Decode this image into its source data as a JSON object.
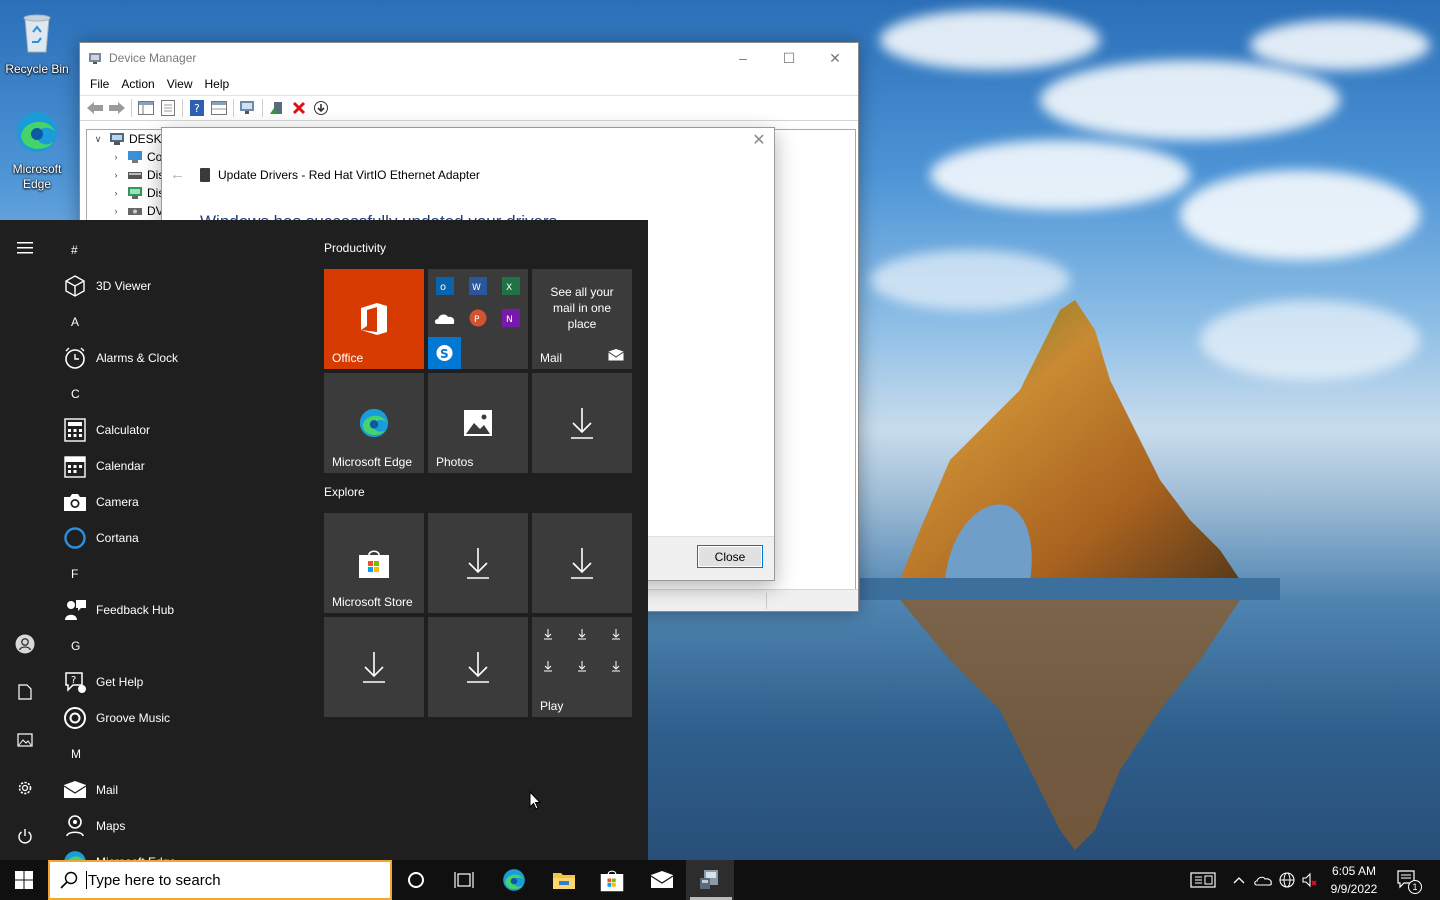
{
  "desktop": {
    "icons": [
      {
        "label": "Recycle Bin"
      },
      {
        "label": "Microsoft Edge"
      }
    ]
  },
  "device_manager": {
    "title": "Device Manager",
    "menu": [
      "File",
      "Action",
      "View",
      "Help"
    ],
    "tree": [
      {
        "label": "DESKT",
        "expanded": true
      },
      {
        "label": "Co"
      },
      {
        "label": "Dis"
      },
      {
        "label": "Dis"
      },
      {
        "label": "DV"
      }
    ]
  },
  "update_dialog": {
    "title": "Update Drivers - Red Hat VirtIO Ethernet Adapter",
    "message": "Windows has successfully updated your drivers",
    "close_label": "Close"
  },
  "start_menu": {
    "app_list": [
      {
        "type": "letter",
        "label": "#"
      },
      {
        "type": "app",
        "label": "3D Viewer",
        "icon": "cube-icon"
      },
      {
        "type": "letter",
        "label": "A"
      },
      {
        "type": "app",
        "label": "Alarms & Clock",
        "icon": "clock-icon"
      },
      {
        "type": "letter",
        "label": "C"
      },
      {
        "type": "app",
        "label": "Calculator",
        "icon": "calculator-icon"
      },
      {
        "type": "app",
        "label": "Calendar",
        "icon": "calendar-icon"
      },
      {
        "type": "app",
        "label": "Camera",
        "icon": "camera-icon"
      },
      {
        "type": "app",
        "label": "Cortana",
        "icon": "cortana-icon"
      },
      {
        "type": "letter",
        "label": "F"
      },
      {
        "type": "app",
        "label": "Feedback Hub",
        "icon": "feedback-icon"
      },
      {
        "type": "letter",
        "label": "G"
      },
      {
        "type": "app",
        "label": "Get Help",
        "icon": "help-icon"
      },
      {
        "type": "app",
        "label": "Groove Music",
        "icon": "music-icon"
      },
      {
        "type": "letter",
        "label": "M"
      },
      {
        "type": "app",
        "label": "Mail",
        "icon": "mail-icon"
      },
      {
        "type": "app",
        "label": "Maps",
        "icon": "maps-icon"
      },
      {
        "type": "app",
        "label": "Microsoft Edge",
        "icon": "edge-icon"
      }
    ],
    "groups": [
      {
        "title": "Productivity"
      },
      {
        "title": "Explore"
      }
    ],
    "tiles": {
      "office": "Office",
      "mail_text": "See all your mail in one place",
      "mail": "Mail",
      "edge": "Microsoft Edge",
      "photos": "Photos",
      "store": "Microsoft Store",
      "play": "Play"
    }
  },
  "taskbar": {
    "search_placeholder": "Type here to search",
    "time": "6:05 AM",
    "date": "9/9/2022",
    "notification_count": "1"
  },
  "colors": {
    "office_tile": "#d83b01",
    "taskbar": "#101010",
    "start_bg": "#1f1f1f",
    "tile_bg": "#3b3b3b",
    "accent": "#0078d7"
  }
}
